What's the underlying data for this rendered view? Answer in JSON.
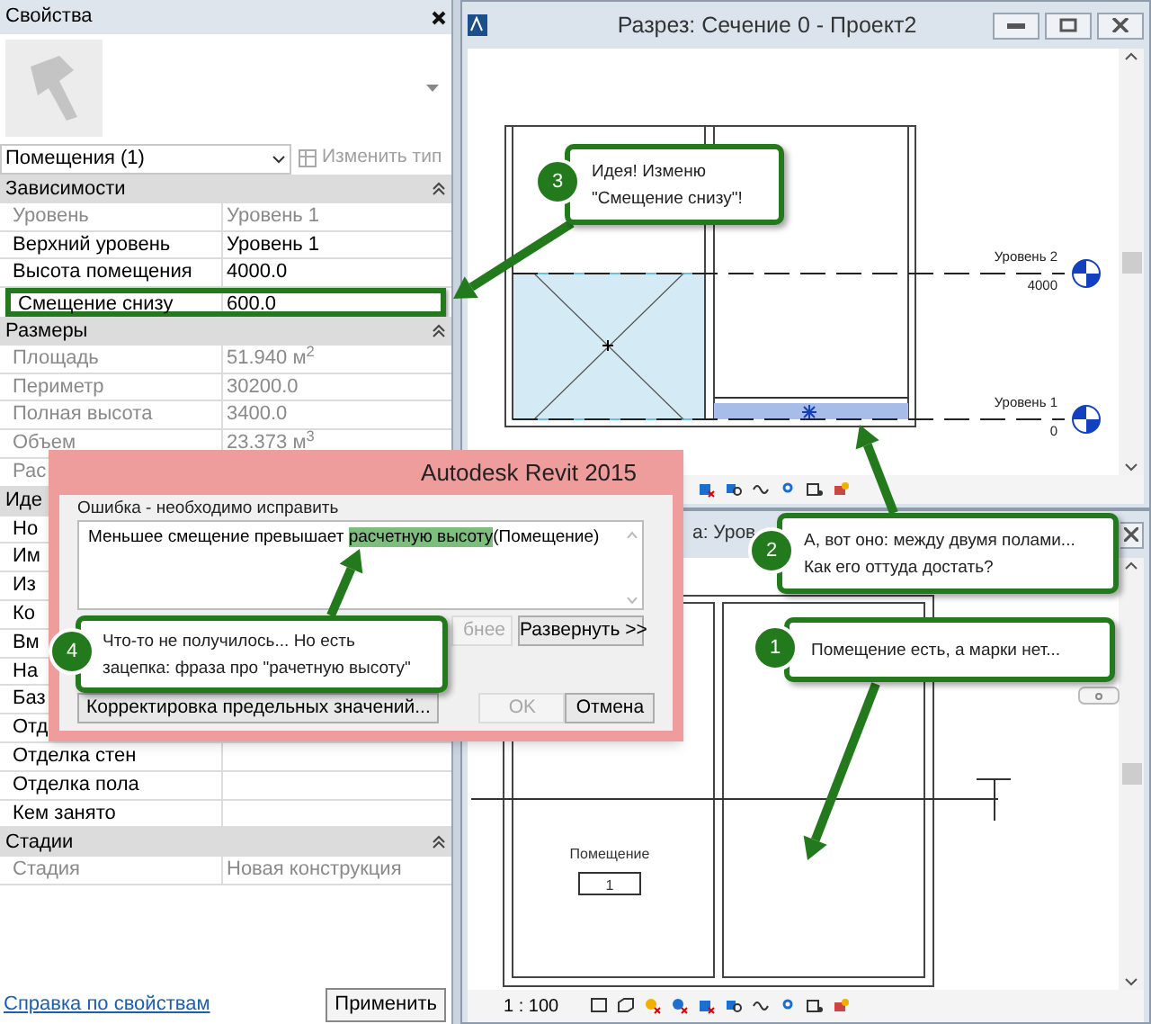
{
  "properties_panel": {
    "title": "Свойства",
    "type_selector": "Помещения (1)",
    "edit_type_button": {
      "label": "Изменить тип",
      "disabled": true
    },
    "sections": [
      {
        "title": "Зависимости",
        "expanded": true,
        "rows": [
          {
            "label": "Уровень",
            "value": "Уровень 1",
            "greyed": true,
            "highlighted": false
          },
          {
            "label": "Верхний уровень",
            "value": "Уровень 1",
            "greyed": false,
            "highlighted": false
          },
          {
            "label": "Высота помещения",
            "value": "4000.0",
            "greyed": false,
            "highlighted": false
          },
          {
            "label": "Смещение снизу",
            "value": "600.0",
            "greyed": false,
            "highlighted": true
          }
        ]
      },
      {
        "title": "Размеры",
        "expanded": true,
        "rows": [
          {
            "label": "Площадь",
            "value": "51.940 м$^{2}$",
            "greyed": true,
            "highlighted": false
          },
          {
            "label": "Периметр",
            "value": "30200.0",
            "greyed": true,
            "highlighted": false
          },
          {
            "label": "Полная высота",
            "value": "3400.0",
            "greyed": true,
            "highlighted": false
          },
          {
            "label": "Объем",
            "value": "23.373 м$^{3}$",
            "greyed": true,
            "highlighted": false
          },
          {
            "label": "Рас",
            "greyed": true,
            "highlighted": false
          }
        ]
      },
      {
        "title": "Иде",
        "rows": [
          {
            "label": "Но",
            "greyed": false,
            "highlighted": false
          },
          {
            "label": "Им",
            "greyed": false,
            "highlighted": false
          },
          {
            "label": "Из",
            "greyed": false,
            "highlighted": false
          },
          {
            "label": "Ко",
            "greyed": false,
            "highlighted": false
          },
          {
            "label": "Вм",
            "greyed": false,
            "highlighted": false
          },
          {
            "label": "На",
            "greyed": false,
            "highlighted": false
          },
          {
            "label": "Баз",
            "greyed": false,
            "highlighted": false
          },
          {
            "label": "Отд",
            "greyed": false,
            "highlighted": false
          },
          {
            "label": "Отделка стен",
            "greyed": false,
            "highlighted": false
          },
          {
            "label": "Отделка пола",
            "greyed": false,
            "highlighted": false
          },
          {
            "label": "Кем занято",
            "greyed": false,
            "highlighted": false
          }
        ]
      },
      {
        "title": "Стадии",
        "expanded": true,
        "rows": [
          {
            "label": "Стадия",
            "value": "Новая конструкция",
            "greyed": true,
            "highlighted": false
          }
        ]
      }
    ],
    "help_link": "Справка по свойствам",
    "apply_button": "Применить"
  },
  "section_view": {
    "title": "Разрез: Сечение 0 - Проект2",
    "levels": [
      {
        "name": "Уровень 2",
        "elevation": "4000"
      },
      {
        "name": "Уровень 1",
        "elevation": "0"
      }
    ]
  },
  "plan_view": {
    "title": "а: Уров",
    "room_label": "Помещение",
    "room_tag": "1",
    "scale": "1 : 100"
  },
  "dialog": {
    "title": "Autodesk Revit 2015",
    "group_label": "Ошибка - необходимо исправить",
    "message": [
      {
        "text": "Меньшее смещение превышает ",
        "highlighted": false
      },
      {
        "text": "расчетную высоту",
        "highlighted": true
      },
      {
        "text": "(Помещение)",
        "highlighted": false
      }
    ],
    "buttons": [
      {
        "label": "бнее",
        "disabled": true
      },
      {
        "label": "Развернуть >>",
        "disabled": false
      }
    ],
    "footer_buttons": [
      {
        "label": "Корректировка предельных значений...",
        "disabled": false
      },
      {
        "label": "OK",
        "disabled": true
      },
      {
        "label": "Отмена",
        "disabled": false
      }
    ]
  },
  "callouts": [
    {
      "number": "3",
      "text": "Идея! Изменю\n\"Смещение снизу\"!"
    },
    {
      "number": "2",
      "text": "А, вот оно: между двумя полами...\nКак его оттуда достать?"
    },
    {
      "number": "4",
      "text": "Что-то не получилось... Но есть\nзацепка: фраза про \"рачетную высоту\""
    },
    {
      "number": "1",
      "text": "Помещение есть, а марки нет..."
    }
  ]
}
